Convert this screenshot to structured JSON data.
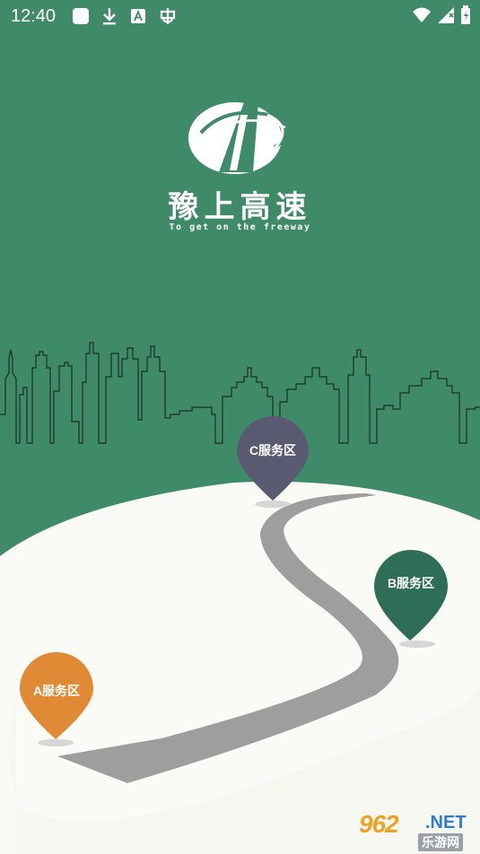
{
  "status_bar": {
    "time": "12:40",
    "left_icons": [
      "app-square-icon",
      "download-icon",
      "translate-a-icon",
      "bug-icon"
    ],
    "right_icons": [
      "wifi-icon",
      "signal-icon",
      "battery-icon"
    ]
  },
  "splash": {
    "title": "豫上高速",
    "subtitle": "To get on the freeway"
  },
  "pins": {
    "a": {
      "label": "A服务区",
      "color": "#e08a35"
    },
    "b": {
      "label": "B服务区",
      "color": "#2e6e58"
    },
    "c": {
      "label": "C服务区",
      "color": "#5a5a72"
    }
  },
  "watermark": {
    "main": "962",
    "net": ".NET",
    "sub": "乐游网"
  },
  "colors": {
    "background": "#3f8a69",
    "ground": "#fafaf7",
    "road": "#9e9e9e"
  }
}
